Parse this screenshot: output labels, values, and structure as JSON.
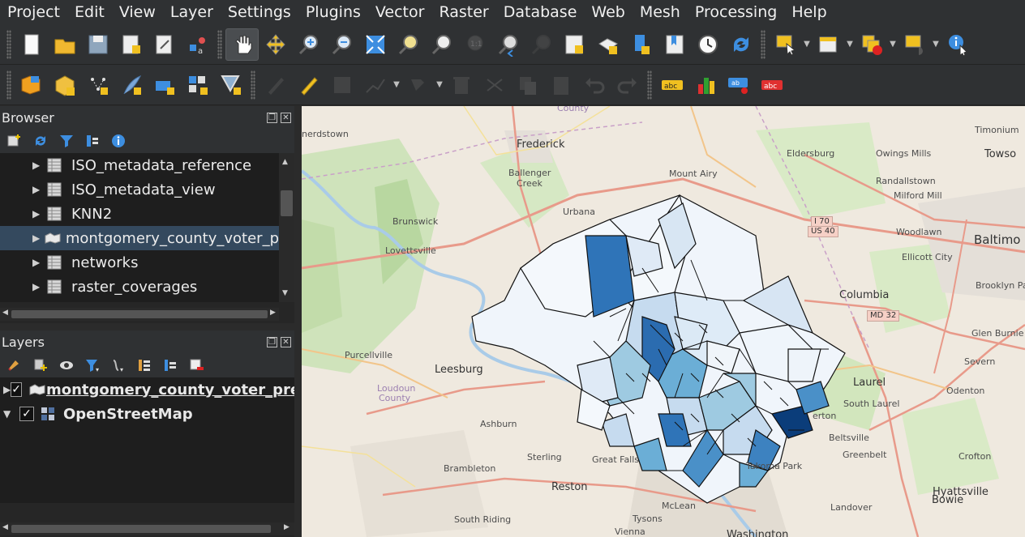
{
  "menu": [
    "Project",
    "Edit",
    "View",
    "Layer",
    "Settings",
    "Plugins",
    "Vector",
    "Raster",
    "Database",
    "Web",
    "Mesh",
    "Processing",
    "Help"
  ],
  "toolbar1": [
    "new-project",
    "open-project",
    "save-project",
    "new-print-layout",
    "layout-manager",
    "style-manager",
    "pan-map",
    "pan-to-selection",
    "zoom-in",
    "zoom-out",
    "zoom-full",
    "zoom-to-selection",
    "zoom-to-layer",
    "zoom-native",
    "zoom-last",
    "zoom-next",
    "new-map-view",
    "new-3d-view",
    "new-bookmark",
    "show-bookmarks",
    "temporal-controller",
    "refresh",
    "select-features",
    "open-attribute-table",
    "deselect",
    "select-by-location",
    "identify-features"
  ],
  "toolbar2": [
    "data-source-manager",
    "new-geopackage-layer",
    "new-shapefile-layer",
    "new-spatialite-layer",
    "new-temporary-layer",
    "new-virtual-layer",
    "new-mesh-layer",
    "current-edits",
    "toggle-editing",
    "save-edits",
    "digitize",
    "vertex-tool",
    "delete-selected",
    "cut-features",
    "copy-features",
    "paste-features",
    "undo",
    "redo",
    "label-toolbar",
    "diagram-options",
    "highlight-pinned",
    "label-settings"
  ],
  "browser": {
    "title": "Browser",
    "items": [
      {
        "label": "ISO_metadata_reference",
        "type": "table"
      },
      {
        "label": "ISO_metadata_view",
        "type": "table"
      },
      {
        "label": "KNN2",
        "type": "table"
      },
      {
        "label": "montgomery_county_voter_p",
        "type": "polygon",
        "selected": true
      },
      {
        "label": "networks",
        "type": "table"
      },
      {
        "label": "raster_coverages",
        "type": "table"
      }
    ]
  },
  "layers": {
    "title": "Layers",
    "items": [
      {
        "label": "montgomery_county_voter_pre",
        "checked": true,
        "expanded": false,
        "underlined": true
      },
      {
        "label": "OpenStreetMap",
        "checked": true,
        "expanded": true,
        "underlined": false
      }
    ]
  },
  "map": {
    "labels": [
      {
        "text": "nerdstown",
        "cls": ""
      },
      {
        "text": "Frederick",
        "cls": "big"
      },
      {
        "text": "Ballenger",
        "cls": ""
      },
      {
        "text": "Creek",
        "cls": ""
      },
      {
        "text": "Mount Airy",
        "cls": ""
      },
      {
        "text": "Eldersburg",
        "cls": ""
      },
      {
        "text": "Owings Mills",
        "cls": ""
      },
      {
        "text": "Timonium",
        "cls": ""
      },
      {
        "text": "Towso",
        "cls": "big"
      },
      {
        "text": "Randallstown",
        "cls": ""
      },
      {
        "text": "Milford Mill",
        "cls": ""
      },
      {
        "text": "Urbana",
        "cls": ""
      },
      {
        "text": "Brunswick",
        "cls": ""
      },
      {
        "text": "Woodlawn",
        "cls": ""
      },
      {
        "text": "Baltimo",
        "cls": "city"
      },
      {
        "text": "Lovettsville",
        "cls": ""
      },
      {
        "text": "Ellicott City",
        "cls": ""
      },
      {
        "text": "Columbia",
        "cls": "big"
      },
      {
        "text": "Brooklyn Par",
        "cls": ""
      },
      {
        "text": "Purcellville",
        "cls": ""
      },
      {
        "text": "Glen Burnie",
        "cls": ""
      },
      {
        "text": "Severn",
        "cls": ""
      },
      {
        "text": "Leesburg",
        "cls": "big"
      },
      {
        "text": "Loudoun",
        "cls": ""
      },
      {
        "text": "County",
        "cls": ""
      },
      {
        "text": "Laurel",
        "cls": "big"
      },
      {
        "text": "South Laurel",
        "cls": ""
      },
      {
        "text": "Odenton",
        "cls": ""
      },
      {
        "text": "Beltsville",
        "cls": ""
      },
      {
        "text": "Ashburn",
        "cls": ""
      },
      {
        "text": "Greenbelt",
        "cls": ""
      },
      {
        "text": "Sterling",
        "cls": ""
      },
      {
        "text": "Great Falls",
        "cls": ""
      },
      {
        "text": "Brambleton",
        "cls": ""
      },
      {
        "text": "Crofton",
        "cls": ""
      },
      {
        "text": "Reston",
        "cls": "big"
      },
      {
        "text": "Hyattsville",
        "cls": "big"
      },
      {
        "text": "Bowie",
        "cls": "big"
      },
      {
        "text": "South Riding",
        "cls": ""
      },
      {
        "text": "Tysons",
        "cls": ""
      },
      {
        "text": "McLean",
        "cls": ""
      },
      {
        "text": "Landover",
        "cls": ""
      },
      {
        "text": "Vienna",
        "cls": ""
      },
      {
        "text": "Takoma Park",
        "cls": ""
      },
      {
        "text": "erton",
        "cls": ""
      },
      {
        "text": "County",
        "cls": ""
      },
      {
        "text": "Washington",
        "cls": "big"
      }
    ],
    "shields": [
      "I 70",
      "US 40",
      "MD 32"
    ]
  }
}
